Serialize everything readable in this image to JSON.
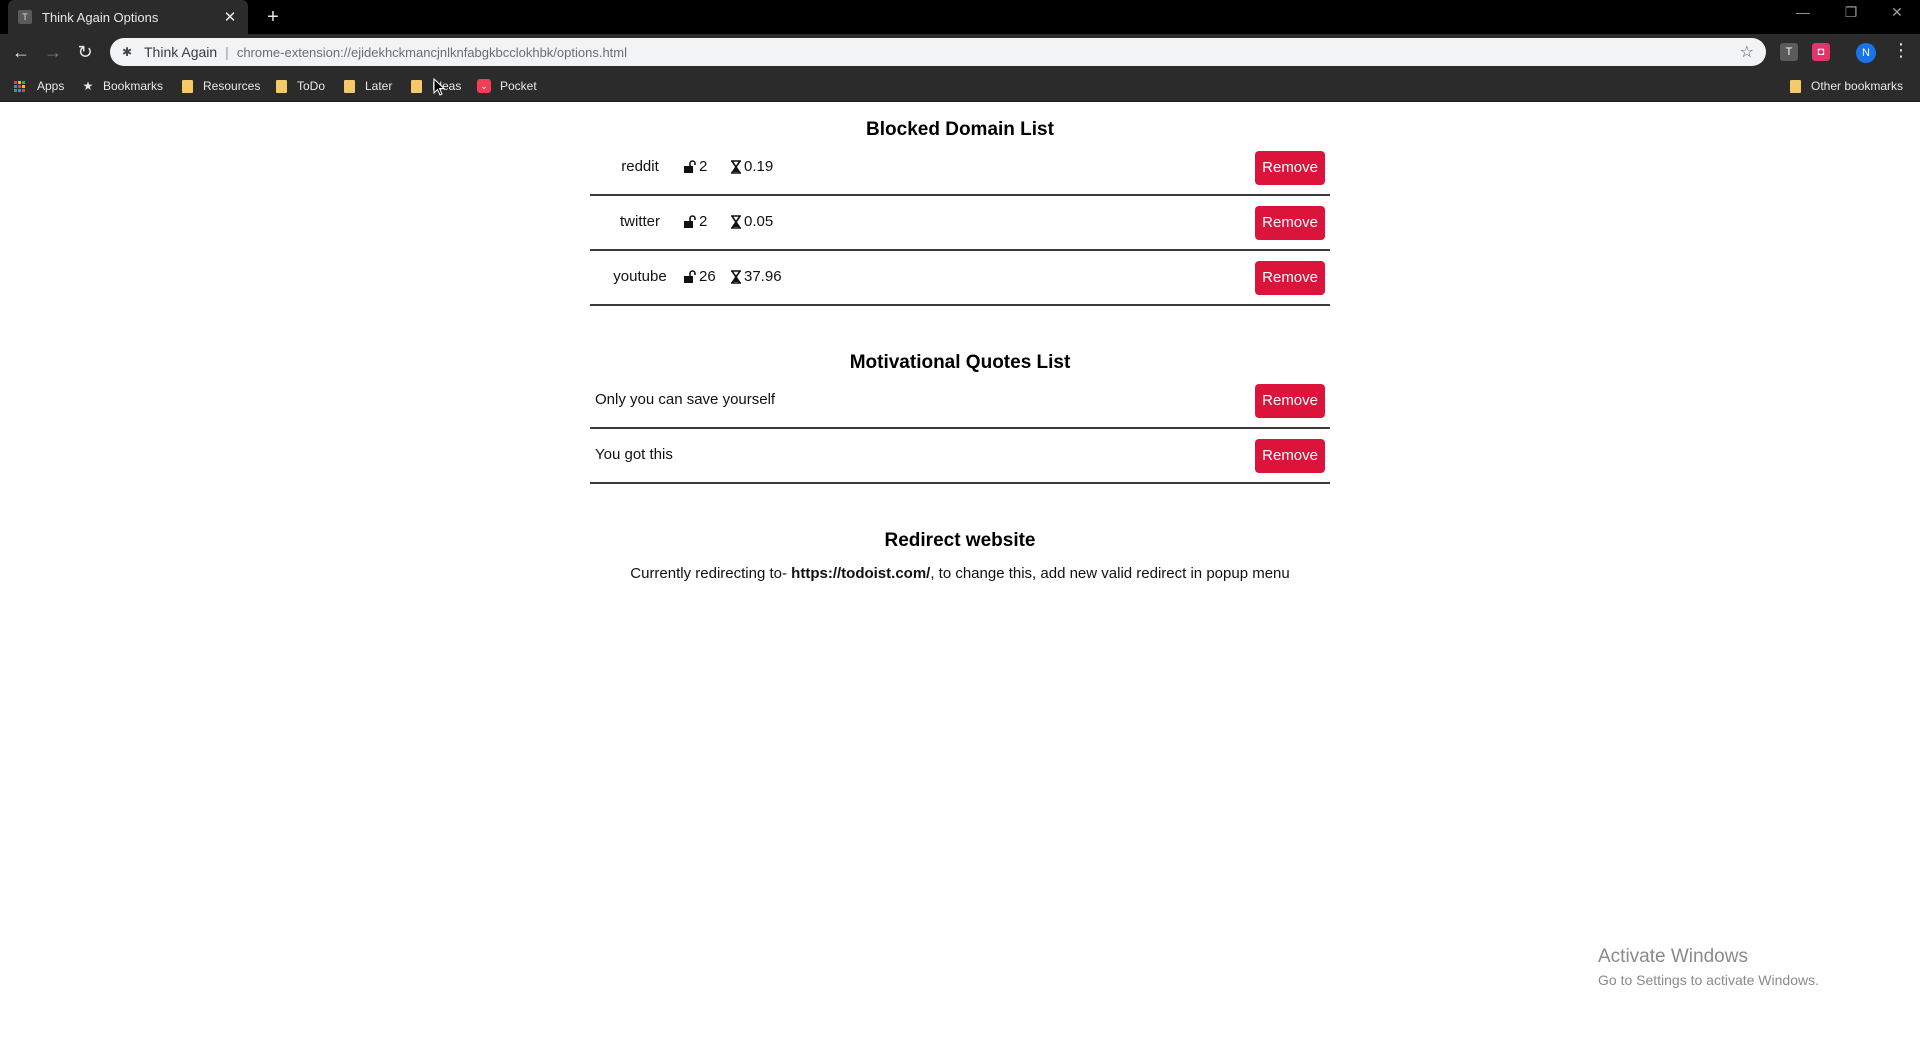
{
  "browser": {
    "tab_title": "Think Again Options",
    "tab_favicon_letter": "T",
    "omnibox_origin": "Think Again",
    "omnibox_url": "chrome-extension://ejidekhckmancjnlknfabgkbcclokhbk/options.html",
    "profile_initial": "N",
    "extension_letter": "T"
  },
  "bookmarks": {
    "apps": "Apps",
    "bookmarks": "Bookmarks",
    "resources": "Resources",
    "todo": "ToDo",
    "later": "Later",
    "ideas": "Ideas",
    "pocket": "Pocket",
    "other": "Other bookmarks"
  },
  "blocked": {
    "title": "Blocked Domain List",
    "remove_label": "Remove",
    "items": [
      {
        "domain": "reddit",
        "unlocks": "2",
        "time": "0.19"
      },
      {
        "domain": "twitter",
        "unlocks": "2",
        "time": "0.05"
      },
      {
        "domain": "youtube",
        "unlocks": "26",
        "time": "37.96"
      }
    ]
  },
  "quotes": {
    "title": "Motivational Quotes List",
    "remove_label": "Remove",
    "items": [
      {
        "text": "Only you can save yourself"
      },
      {
        "text": "You got this"
      }
    ]
  },
  "redirect": {
    "title": "Redirect website",
    "prefix": "Currently redirecting to-",
    "url": "https://todoist.com/",
    "suffix": ", to change this, add new valid redirect in popup menu"
  },
  "watermark": {
    "title": "Activate Windows",
    "subtitle": "Go to Settings to activate Windows."
  },
  "colors": {
    "remove_button": "#dc143c",
    "chrome_dark": "#2b2b2b",
    "folder": "#f5c869"
  },
  "icons": {
    "unlock": "unlock-icon",
    "hourglass": "hourglass-icon"
  }
}
